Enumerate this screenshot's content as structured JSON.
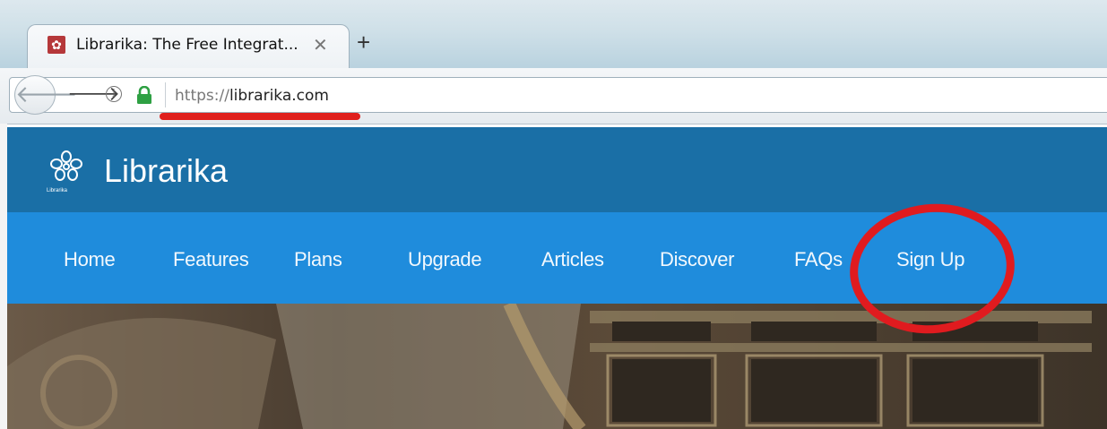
{
  "browser": {
    "tab_title": "Librarika: The Free Integrat...",
    "tab_close": "✕",
    "new_tab": "+",
    "back": "🡐",
    "forward": "🡒",
    "url_scheme": "https://",
    "url_host": "librarika.com"
  },
  "site": {
    "logo_text": "Librarika",
    "title": "Librarika",
    "nav": [
      {
        "label": "Home"
      },
      {
        "label": "Features"
      },
      {
        "label": "Plans"
      },
      {
        "label": "Upgrade"
      },
      {
        "label": "Articles"
      },
      {
        "label": "Discover"
      },
      {
        "label": "FAQs"
      },
      {
        "label": "Sign Up"
      }
    ]
  },
  "colors": {
    "header": "#1a6fa6",
    "nav": "#1f8cdc",
    "annotation": "#e01b1f"
  }
}
